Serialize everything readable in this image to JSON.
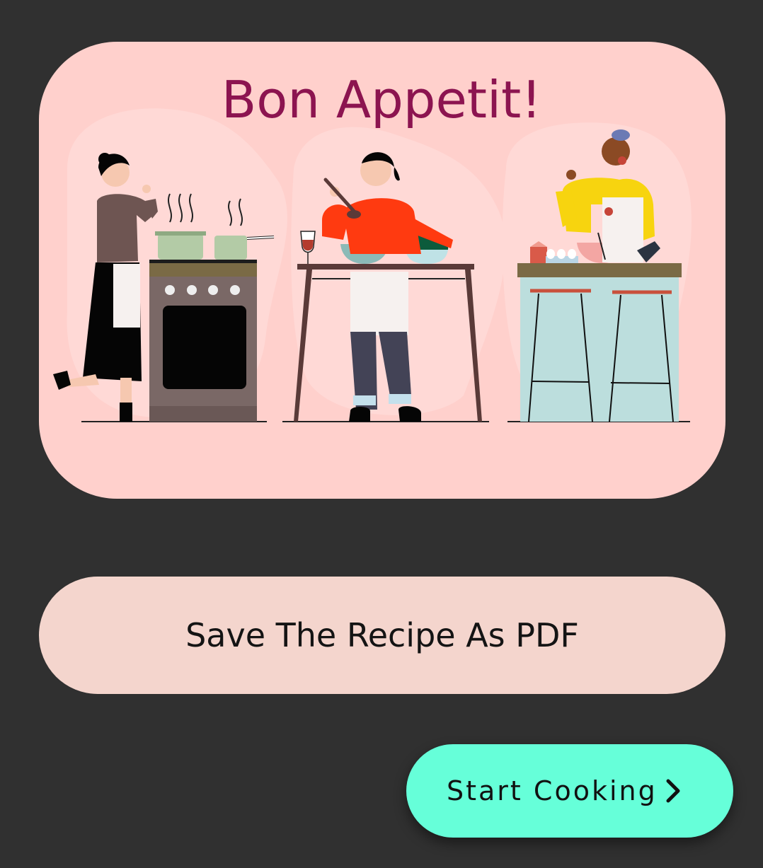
{
  "card": {
    "title": "Bon Appetit!",
    "illustration": "three-cooks-kitchen-illustration",
    "background_color": "#ffd0cc",
    "title_color": "#8c1450"
  },
  "actions": {
    "save_pdf_label": "Save The Recipe As PDF",
    "start_cooking_label": "Start Cooking",
    "start_cooking_icon": "chevron-right-icon",
    "accent_color": "#66ffd9"
  }
}
